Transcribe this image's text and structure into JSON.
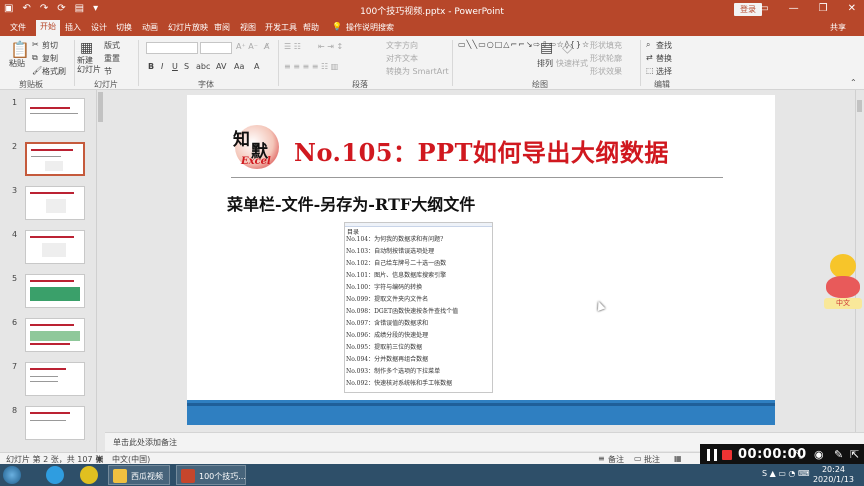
{
  "window": {
    "title": "100个技巧视频.pptx  -  PowerPoint",
    "login_label": "登录",
    "share_label": "共享"
  },
  "tabs": [
    "文件",
    "开始",
    "插入",
    "设计",
    "切换",
    "动画",
    "幻灯片放映",
    "审阅",
    "视图",
    "开发工具",
    "帮助",
    "操作说明搜索"
  ],
  "active_tab": "开始",
  "ribbon": {
    "clipboard": {
      "paste": "粘贴",
      "cut": "剪切",
      "copy": "复制",
      "format_painter": "格式刷",
      "label": "剪贴板"
    },
    "slides": {
      "new_slide": "新建\n幻灯片",
      "layout": "版式",
      "reset": "重置",
      "section": "节",
      "label": "幻灯片"
    },
    "font": {
      "label": "字体"
    },
    "paragraph": {
      "text_direction": "文字方向",
      "align_text": "对齐文本",
      "convert_smartart": "转换为 SmartArt",
      "label": "段落"
    },
    "drawing": {
      "arrange": "排列",
      "quick_styles": "快速样式",
      "shape_fill": "形状填充",
      "shape_outline": "形状轮廓",
      "shape_effects": "形状效果",
      "label": "绘图"
    },
    "editing": {
      "find": "查找",
      "replace": "替换",
      "select": "选择",
      "label": "编辑"
    }
  },
  "thumbnails": [
    "1",
    "2",
    "3",
    "4",
    "5",
    "6",
    "7",
    "8"
  ],
  "selected_slide": 2,
  "slide": {
    "logo_chars": [
      "知",
      "默"
    ],
    "logo_text": "Excel",
    "title": "No.105：PPT如何导出大纲数据",
    "subtitle": "菜单栏-文件-另存为-RTF大纲文件",
    "outline_heading": "目录",
    "outline_items": [
      "No.104：为何我的数据求和有问题?",
      "No.103：自动制按错误选项处理",
      "No.102：自己给车牌号二十选一函数",
      "No.101：图片、信息数据库搜索引擎",
      "No.100：字符与编码的转换",
      "No.099：提取文件夹内文件名",
      "No.098：DGET函数快速按条件查找个值",
      "No.097：含错误值的数据求和",
      "No.096：成绩分段的快速处理",
      "No.095：提取前三位的数据",
      "No.094：分并数据再组合数据",
      "No.093：制作多个选项的下拉菜单",
      "No.092：快速核对系统帐和手工帐数据"
    ]
  },
  "notes_placeholder": "单击此处添加备注",
  "status": {
    "slide_info": "幻灯片 第 2 张，共 107 张",
    "language": "中文(中国)",
    "notes": "备注",
    "comments": "批注"
  },
  "recorder": {
    "time": "00:00:00"
  },
  "mascot_label": "中文",
  "taskbar": {
    "tasks": [
      "西瓜视频",
      "100个技巧..."
    ],
    "time": "20:24",
    "date": "2020/1/13"
  },
  "colors": {
    "accent": "#b7472a",
    "title_red": "#d0181f",
    "slide_bar": "#2f7fc1"
  }
}
